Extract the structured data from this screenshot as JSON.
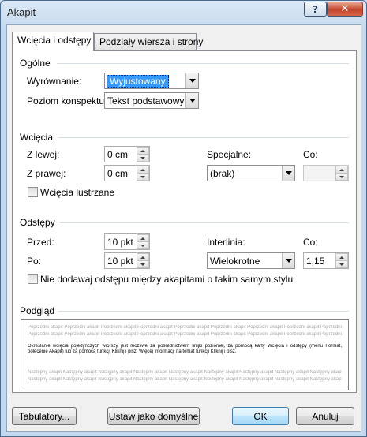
{
  "window": {
    "title": "Akapit",
    "help_label": "?",
    "close_label": "✕"
  },
  "tabs": [
    {
      "label": "Wcięcia i odstępy",
      "active": true
    },
    {
      "label": "Podziały wiersza i strony",
      "active": false
    }
  ],
  "general": {
    "heading": "Ogólne",
    "alignment": {
      "label": "Wyrównanie:",
      "value": "Wyjustowany"
    },
    "outline": {
      "label": "Poziom konspektu:",
      "value": "Tekst podstawowy"
    }
  },
  "indent": {
    "heading": "Wcięcia",
    "left": {
      "label": "Z lewej:",
      "value": "0 cm"
    },
    "right": {
      "label": "Z prawej:",
      "value": "0 cm"
    },
    "special": {
      "label": "Specjalne:",
      "value": "(brak)"
    },
    "by": {
      "label": "Co:",
      "value": ""
    },
    "mirror": {
      "label": "Wcięcia lustrzane",
      "checked": false
    }
  },
  "spacing": {
    "heading": "Odstępy",
    "before": {
      "label": "Przed:",
      "value": "10 pkt"
    },
    "after": {
      "label": "Po:",
      "value": "10 pkt"
    },
    "line": {
      "label": "Interlinia:",
      "value": "Wielokrotne"
    },
    "at": {
      "label": "Co:",
      "value": "1,15"
    },
    "no_space": {
      "label": "Nie dodawaj odstępu między akapitami o takim samym stylu",
      "checked": false
    }
  },
  "preview": {
    "heading": "Podgląd",
    "prev_text": "Poprzedni akapit Poprzedni akapit Poprzedni akapit Poprzedni akapit Poprzedni akapit Poprzedni akapit Poprzedni akapit Poprzedni akapit Poprzedni akapit",
    "main_text": "Określanie wcięcia pojedynczych wiorszy jest możliwe za pośrednictwem linijki poziomej, za pomocą karty Wcięcia i odstępy (menu Format, polecenie Akapit) lub za pomocą funkcji Kliknij i pisz. Więcej informacji na temat funkcji Kliknij i pisz.",
    "next_text": "Następny akapit Następny akapit Następny akapit Następny akapit Następny akapit Następny akapit Następny akapit Następny akapit Następny akapit"
  },
  "buttons": {
    "tabs": "Tabulatory...",
    "set_default": "Ustaw jako domyślne",
    "ok": "OK",
    "cancel": "Anuluj"
  },
  "colors": {
    "selection": "#3399ff",
    "title_close": "#c4452b"
  }
}
